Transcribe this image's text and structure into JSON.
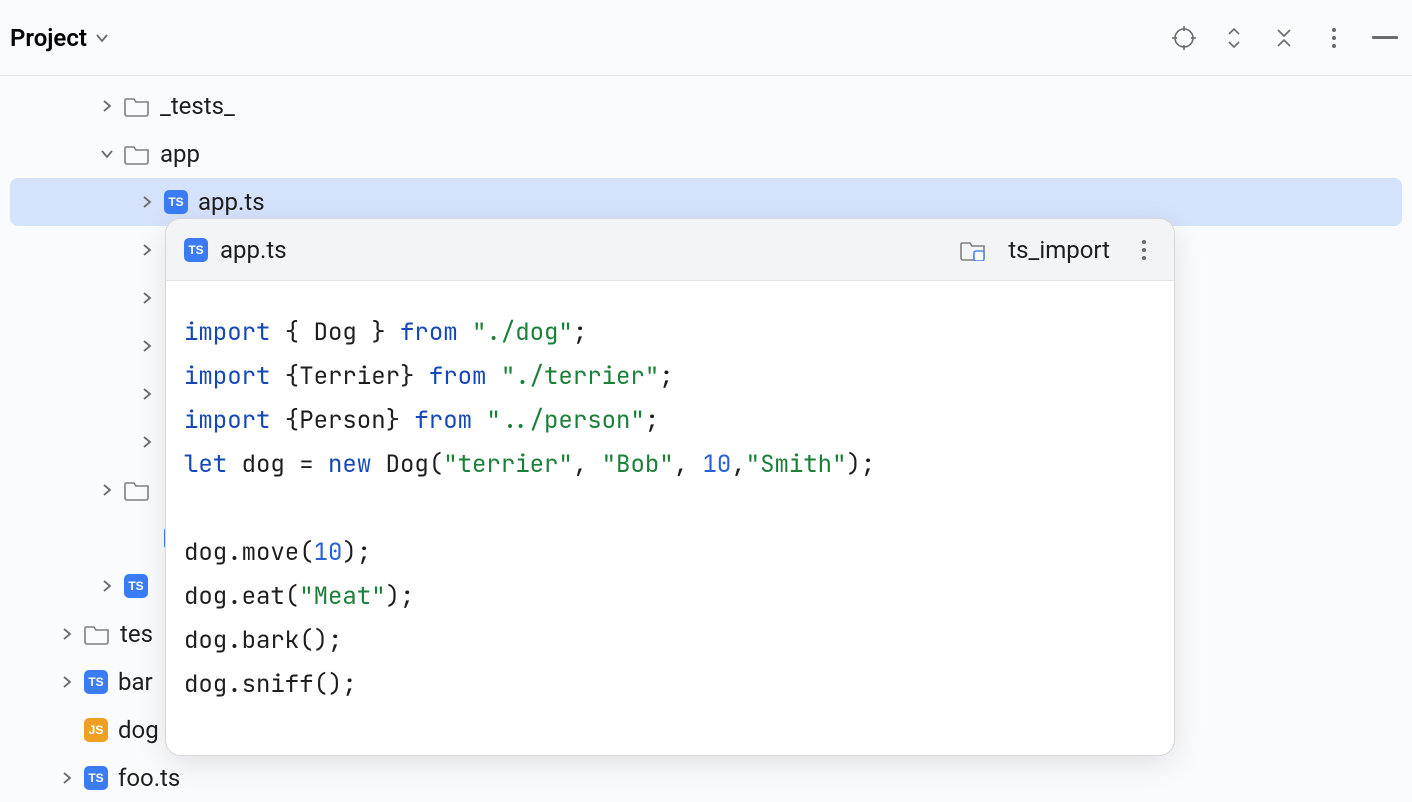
{
  "header": {
    "title": "Project"
  },
  "tree": {
    "items": [
      {
        "label": "_tests_",
        "kind": "folder",
        "depth": 1,
        "chev": "right"
      },
      {
        "label": "app",
        "kind": "folder",
        "depth": 1,
        "chev": "down"
      },
      {
        "label": "app.ts",
        "kind": "ts",
        "depth": 2,
        "chev": "right",
        "selected": true
      },
      {
        "label": "",
        "kind": "none",
        "depth": 2,
        "chev": "right"
      },
      {
        "label": "",
        "kind": "none",
        "depth": 2,
        "chev": "right"
      },
      {
        "label": "",
        "kind": "none",
        "depth": 2,
        "chev": "right"
      },
      {
        "label": "",
        "kind": "none",
        "depth": 2,
        "chev": "right"
      },
      {
        "label": "",
        "kind": "none",
        "depth": 2,
        "chev": "right"
      },
      {
        "label": "",
        "kind": "folder",
        "depth": 1,
        "chev": "right"
      },
      {
        "label": "",
        "kind": "ts",
        "depth": 2,
        "chev": "none"
      },
      {
        "label": "",
        "kind": "ts",
        "depth": 2,
        "chev": "right"
      },
      {
        "label": "tes",
        "kind": "folder",
        "depth": 0,
        "chev": "right"
      },
      {
        "label": "bar",
        "kind": "ts",
        "depth": 0,
        "chev": "right"
      },
      {
        "label": "dog",
        "kind": "js",
        "depth": 0,
        "chev": "none"
      },
      {
        "label": "foo.ts",
        "kind": "ts",
        "depth": 0,
        "chev": "right"
      }
    ]
  },
  "preview": {
    "filename": "app.ts",
    "module": "ts_import",
    "code": {
      "l1": {
        "kw1": "import",
        "p1": " { Dog } ",
        "kw2": "from",
        "s": " \"./dog\"",
        "end": ";"
      },
      "l2": {
        "kw1": "import",
        "p1": " {Terrier} ",
        "kw2": "from",
        "s": " \"./terrier\"",
        "end": ";"
      },
      "l3": {
        "kw1": "import",
        "p1": " {Person} ",
        "kw2": "from",
        "s": " \"../person\"",
        "end": ";"
      },
      "l4": {
        "kw1": "let",
        "p1": " dog = ",
        "kw2": "new",
        "p2": " Dog(",
        "s1": "\"terrier\"",
        "c1": ", ",
        "s2": "\"Bob\"",
        "c2": ", ",
        "n": "10",
        "c3": ",",
        "s3": "\"Smith\"",
        "end": ");"
      },
      "l5": "",
      "l6": {
        "p1": "dog.move(",
        "n": "10",
        "end": ");"
      },
      "l7": {
        "p1": "dog.eat(",
        "s": "\"Meat\"",
        "end": ");"
      },
      "l8": "dog.bark();",
      "l9": "dog.sniff();"
    }
  }
}
